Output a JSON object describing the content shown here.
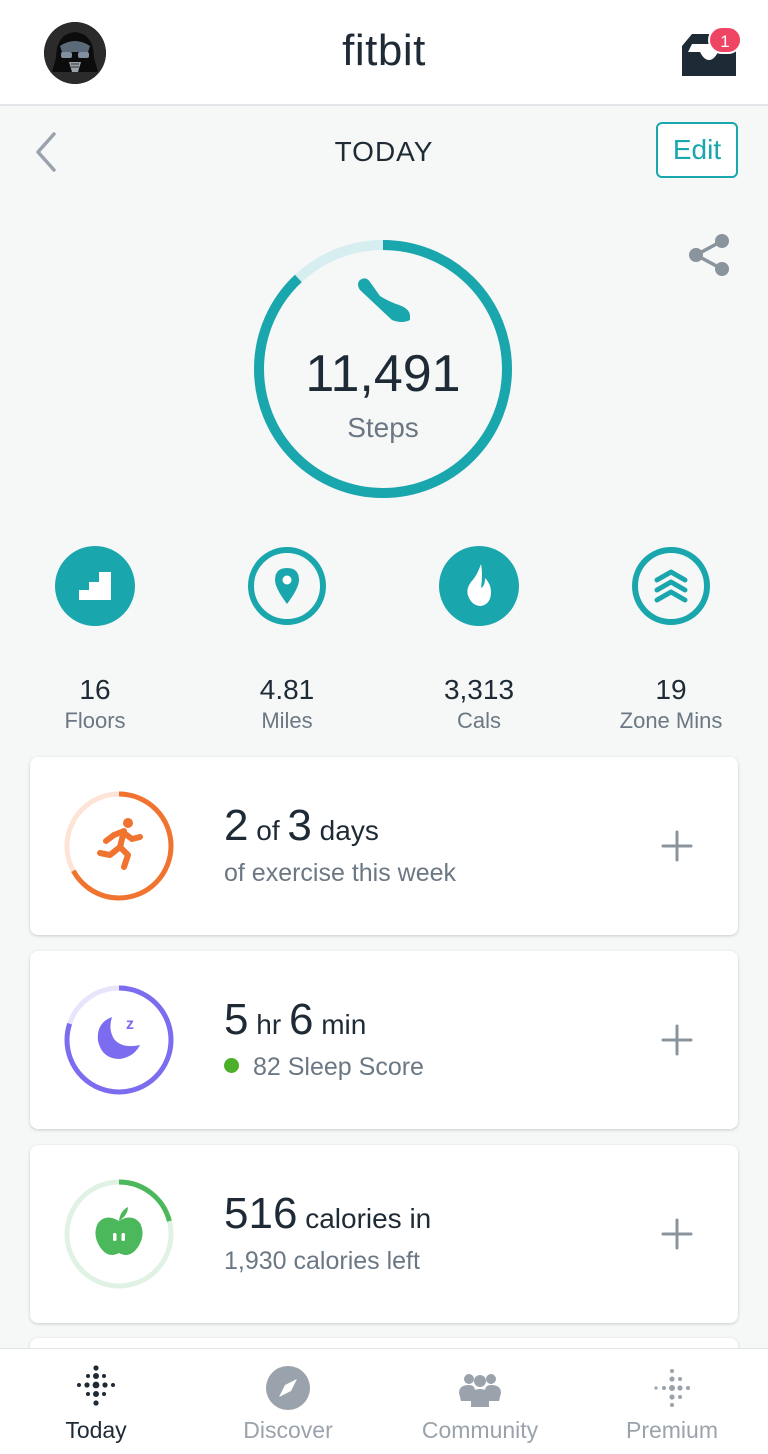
{
  "header": {
    "logo": "fitbit",
    "inbox_badge": "1"
  },
  "subbar": {
    "title": "TODAY",
    "edit_label": "Edit"
  },
  "steps": {
    "value": "11,491",
    "label": "Steps",
    "progress": 0.88,
    "color": "#1aa6ad"
  },
  "stats": [
    {
      "value": "16",
      "label": "Floors",
      "icon": "stairs-icon"
    },
    {
      "value": "4.81",
      "label": "Miles",
      "icon": "location-pin-icon"
    },
    {
      "value": "3,313",
      "label": "Cals",
      "icon": "flame-icon"
    },
    {
      "value": "19",
      "label": "Zone Mins",
      "icon": "zone-chevrons-icon"
    }
  ],
  "cards": {
    "exercise": {
      "n1": "2",
      "t1": " of ",
      "n2": "3",
      "t2": " days",
      "sub": "of exercise this week",
      "progress": 0.67,
      "color": "#f0742f"
    },
    "sleep": {
      "n1": "5",
      "t1": " hr ",
      "n2": "6",
      "t2": " min",
      "sub": "82 Sleep Score",
      "progress": 0.8,
      "color": "#7b6cf0"
    },
    "food": {
      "n1": "516",
      "t1": " calories in",
      "sub": "1,930 calories left",
      "progress": 0.21,
      "color": "#4cb85c"
    }
  },
  "tabs": [
    {
      "label": "Today",
      "icon": "today-dots-icon",
      "active": true
    },
    {
      "label": "Discover",
      "icon": "compass-icon",
      "active": false
    },
    {
      "label": "Community",
      "icon": "community-icon",
      "active": false
    },
    {
      "label": "Premium",
      "icon": "premium-dots-icon",
      "active": false
    }
  ]
}
